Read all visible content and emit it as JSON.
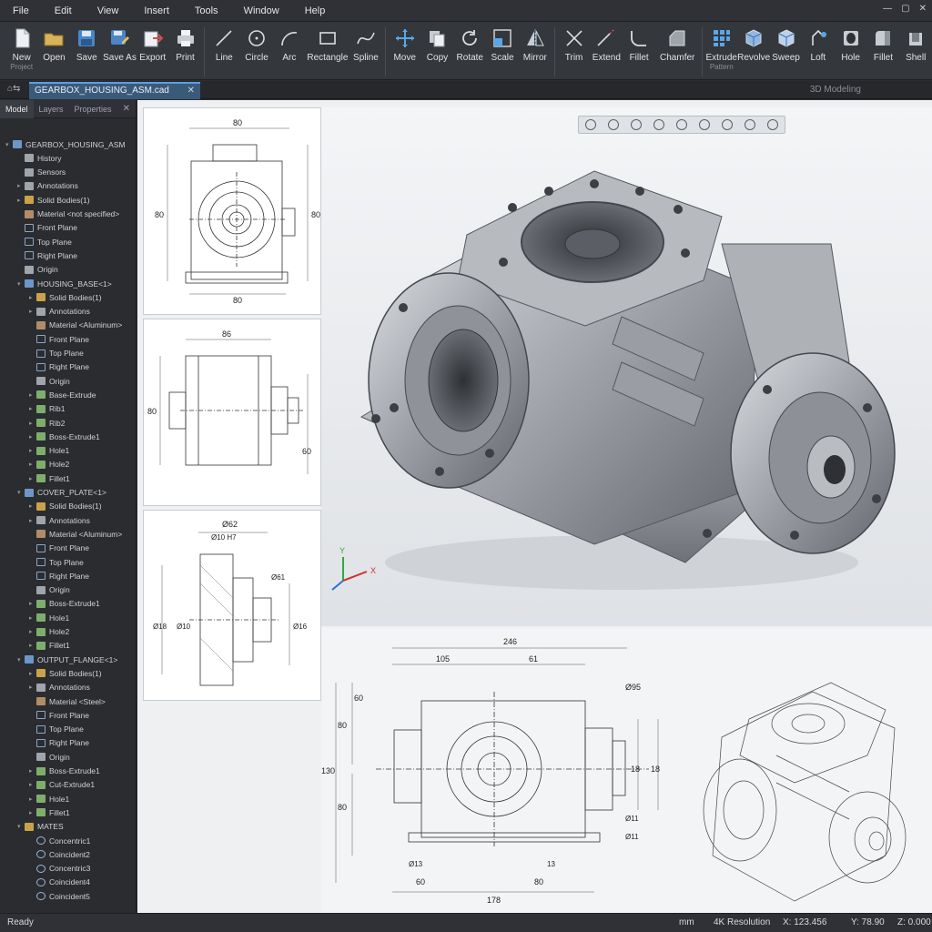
{
  "menu": [
    "File",
    "Edit",
    "View",
    "Insert",
    "Tools",
    "Window",
    "Help"
  ],
  "window_controls": [
    "—",
    "▢",
    "✕"
  ],
  "ribbon": {
    "file_tools": [
      {
        "label": "New",
        "sub": "Project",
        "icon": "new-file-icon"
      },
      {
        "label": "Open",
        "sub": "",
        "icon": "open-folder-icon"
      },
      {
        "label": "Save",
        "sub": "",
        "icon": "save-icon"
      },
      {
        "label": "Save As",
        "sub": "",
        "icon": "save-as-icon"
      },
      {
        "label": "Export",
        "sub": "",
        "icon": "export-icon"
      },
      {
        "label": "Print",
        "sub": "",
        "icon": "print-icon"
      }
    ],
    "sketch_tools": [
      {
        "label": "Line",
        "icon": "line-icon"
      },
      {
        "label": "Circle",
        "icon": "circle-icon"
      },
      {
        "label": "Arc",
        "icon": "arc-icon"
      },
      {
        "label": "Rectangle",
        "icon": "rectangle-icon"
      },
      {
        "label": "Spline",
        "icon": "spline-icon"
      }
    ],
    "modify_tools": [
      {
        "label": "Move",
        "icon": "move-icon"
      },
      {
        "label": "Copy",
        "icon": "copy-icon"
      },
      {
        "label": "Rotate",
        "icon": "rotate-icon"
      },
      {
        "label": "Scale",
        "icon": "scale-icon"
      },
      {
        "label": "Mirror",
        "icon": "mirror-icon"
      }
    ],
    "edit_tools": [
      {
        "label": "Trim",
        "icon": "trim-icon"
      },
      {
        "label": "Extend",
        "icon": "extend-icon"
      },
      {
        "label": "Fillet",
        "icon": "fillet-icon"
      },
      {
        "label": "Chamfer",
        "icon": "chamfer-icon"
      }
    ],
    "feature_tools": [
      {
        "label": "Extrude",
        "sub": "Pattern",
        "icon": "extrude-icon"
      },
      {
        "label": "Revolve",
        "sub": "",
        "icon": "revolve-icon"
      },
      {
        "label": "Sweep",
        "sub": "",
        "icon": "sweep-icon"
      },
      {
        "label": "Loft",
        "sub": "",
        "icon": "loft-icon"
      },
      {
        "label": "Hole",
        "sub": "",
        "icon": "hole-icon"
      },
      {
        "label": "Fillet",
        "sub": "",
        "icon": "fillet-3d-icon"
      },
      {
        "label": "Shell",
        "sub": "",
        "icon": "shell-icon"
      }
    ]
  },
  "tabs": {
    "document": "GEARBOX_HOUSING_ASM.cad",
    "mode": "3D Modeling"
  },
  "panel": {
    "tabs": [
      "Model",
      "Layers",
      "Properties"
    ],
    "tree": [
      {
        "label": "GEARBOX_HOUSING_ASM",
        "depth": 0,
        "icon": "part",
        "arrow": "▾"
      },
      {
        "label": "History",
        "depth": 1,
        "icon": "note",
        "arrow": ""
      },
      {
        "label": "Sensors",
        "depth": 1,
        "icon": "note",
        "arrow": ""
      },
      {
        "label": "Annotations",
        "depth": 1,
        "icon": "note",
        "arrow": "▸"
      },
      {
        "label": "Solid Bodies(1)",
        "depth": 1,
        "icon": "folder",
        "arrow": "▸"
      },
      {
        "label": "Material <not specified>",
        "depth": 1,
        "icon": "mat",
        "arrow": ""
      },
      {
        "label": "Front Plane",
        "depth": 1,
        "icon": "plane",
        "arrow": ""
      },
      {
        "label": "Top Plane",
        "depth": 1,
        "icon": "plane",
        "arrow": ""
      },
      {
        "label": "Right Plane",
        "depth": 1,
        "icon": "plane",
        "arrow": ""
      },
      {
        "label": "Origin",
        "depth": 1,
        "icon": "note",
        "arrow": ""
      },
      {
        "label": "HOUSING_BASE<1>",
        "depth": 1,
        "icon": "part",
        "arrow": "▾"
      },
      {
        "label": "Solid Bodies(1)",
        "depth": 2,
        "icon": "folder",
        "arrow": "▸"
      },
      {
        "label": "Annotations",
        "depth": 2,
        "icon": "note",
        "arrow": "▸"
      },
      {
        "label": "Material <Aluminum>",
        "depth": 2,
        "icon": "mat",
        "arrow": ""
      },
      {
        "label": "Front Plane",
        "depth": 2,
        "icon": "plane",
        "arrow": ""
      },
      {
        "label": "Top Plane",
        "depth": 2,
        "icon": "plane",
        "arrow": ""
      },
      {
        "label": "Right Plane",
        "depth": 2,
        "icon": "plane",
        "arrow": ""
      },
      {
        "label": "Origin",
        "depth": 2,
        "icon": "note",
        "arrow": ""
      },
      {
        "label": "Base-Extrude",
        "depth": 2,
        "icon": "feat",
        "arrow": "▸"
      },
      {
        "label": "Rib1",
        "depth": 2,
        "icon": "feat",
        "arrow": "▸"
      },
      {
        "label": "Rib2",
        "depth": 2,
        "icon": "feat",
        "arrow": "▸"
      },
      {
        "label": "Boss-Extrude1",
        "depth": 2,
        "icon": "feat",
        "arrow": "▸"
      },
      {
        "label": "Hole1",
        "depth": 2,
        "icon": "feat",
        "arrow": "▸"
      },
      {
        "label": "Hole2",
        "depth": 2,
        "icon": "feat",
        "arrow": "▸"
      },
      {
        "label": "Fillet1",
        "depth": 2,
        "icon": "feat",
        "arrow": "▸"
      },
      {
        "label": "COVER_PLATE<1>",
        "depth": 1,
        "icon": "part",
        "arrow": "▾"
      },
      {
        "label": "Solid Bodies(1)",
        "depth": 2,
        "icon": "folder",
        "arrow": "▸"
      },
      {
        "label": "Annotations",
        "depth": 2,
        "icon": "note",
        "arrow": "▸"
      },
      {
        "label": "Material <Aluminum>",
        "depth": 2,
        "icon": "mat",
        "arrow": ""
      },
      {
        "label": "Front Plane",
        "depth": 2,
        "icon": "plane",
        "arrow": ""
      },
      {
        "label": "Top Plane",
        "depth": 2,
        "icon": "plane",
        "arrow": ""
      },
      {
        "label": "Right Plane",
        "depth": 2,
        "icon": "plane",
        "arrow": ""
      },
      {
        "label": "Origin",
        "depth": 2,
        "icon": "note",
        "arrow": ""
      },
      {
        "label": "Boss-Extrude1",
        "depth": 2,
        "icon": "feat",
        "arrow": "▸"
      },
      {
        "label": "Hole1",
        "depth": 2,
        "icon": "feat",
        "arrow": "▸"
      },
      {
        "label": "Hole2",
        "depth": 2,
        "icon": "feat",
        "arrow": "▸"
      },
      {
        "label": "Fillet1",
        "depth": 2,
        "icon": "feat",
        "arrow": "▸"
      },
      {
        "label": "OUTPUT_FLANGE<1>",
        "depth": 1,
        "icon": "part",
        "arrow": "▾"
      },
      {
        "label": "Solid Bodies(1)",
        "depth": 2,
        "icon": "folder",
        "arrow": "▸"
      },
      {
        "label": "Annotations",
        "depth": 2,
        "icon": "note",
        "arrow": "▸"
      },
      {
        "label": "Material <Steel>",
        "depth": 2,
        "icon": "mat",
        "arrow": ""
      },
      {
        "label": "Front Plane",
        "depth": 2,
        "icon": "plane",
        "arrow": ""
      },
      {
        "label": "Top Plane",
        "depth": 2,
        "icon": "plane",
        "arrow": ""
      },
      {
        "label": "Right Plane",
        "depth": 2,
        "icon": "plane",
        "arrow": ""
      },
      {
        "label": "Origin",
        "depth": 2,
        "icon": "note",
        "arrow": ""
      },
      {
        "label": "Boss-Extrude1",
        "depth": 2,
        "icon": "feat",
        "arrow": "▸"
      },
      {
        "label": "Cut-Extrude1",
        "depth": 2,
        "icon": "feat",
        "arrow": "▸"
      },
      {
        "label": "Hole1",
        "depth": 2,
        "icon": "feat",
        "arrow": "▸"
      },
      {
        "label": "Fillet1",
        "depth": 2,
        "icon": "feat",
        "arrow": "▸"
      },
      {
        "label": "MATES",
        "depth": 1,
        "icon": "folder",
        "arrow": "▾"
      },
      {
        "label": "Concentric1",
        "depth": 2,
        "icon": "mate",
        "arrow": ""
      },
      {
        "label": "Coincident2",
        "depth": 2,
        "icon": "mate",
        "arrow": ""
      },
      {
        "label": "Concentric3",
        "depth": 2,
        "icon": "mate",
        "arrow": ""
      },
      {
        "label": "Coincident4",
        "depth": 2,
        "icon": "mate",
        "arrow": ""
      },
      {
        "label": "Coincident5",
        "depth": 2,
        "icon": "mate",
        "arrow": ""
      }
    ]
  },
  "drawings": {
    "view1": {
      "top": "80",
      "bottom": "80",
      "left": "80",
      "right": "80"
    },
    "view2": {
      "top": "86",
      "left": "80",
      "right": "60"
    },
    "view3": {
      "top": "Ø62",
      "sub": "Ø10 H7",
      "left1": "Ø18",
      "left2": "Ø10",
      "right1": "Ø61",
      "right2": "Ø16"
    },
    "main": {
      "overall": "246",
      "seg1": "105",
      "seg2": "61",
      "dia": "Ø95",
      "h_total": "130",
      "h1": "80",
      "h2": "80",
      "h3": "60",
      "r1": "18",
      "r2": "18",
      "bottom": "178",
      "b1": "60",
      "b2": "80",
      "d1": "Ø11",
      "d2": "Ø11",
      "small1": "Ø13",
      "small2": "13"
    }
  },
  "axes": {
    "x": "X",
    "y": "Y",
    "z": "Z"
  },
  "status": {
    "ready": "Ready",
    "units": "mm",
    "resolution": "4K Resolution",
    "x": "X: 123.456",
    "y": "Y: 78.90",
    "z": "Z: 0.000"
  }
}
